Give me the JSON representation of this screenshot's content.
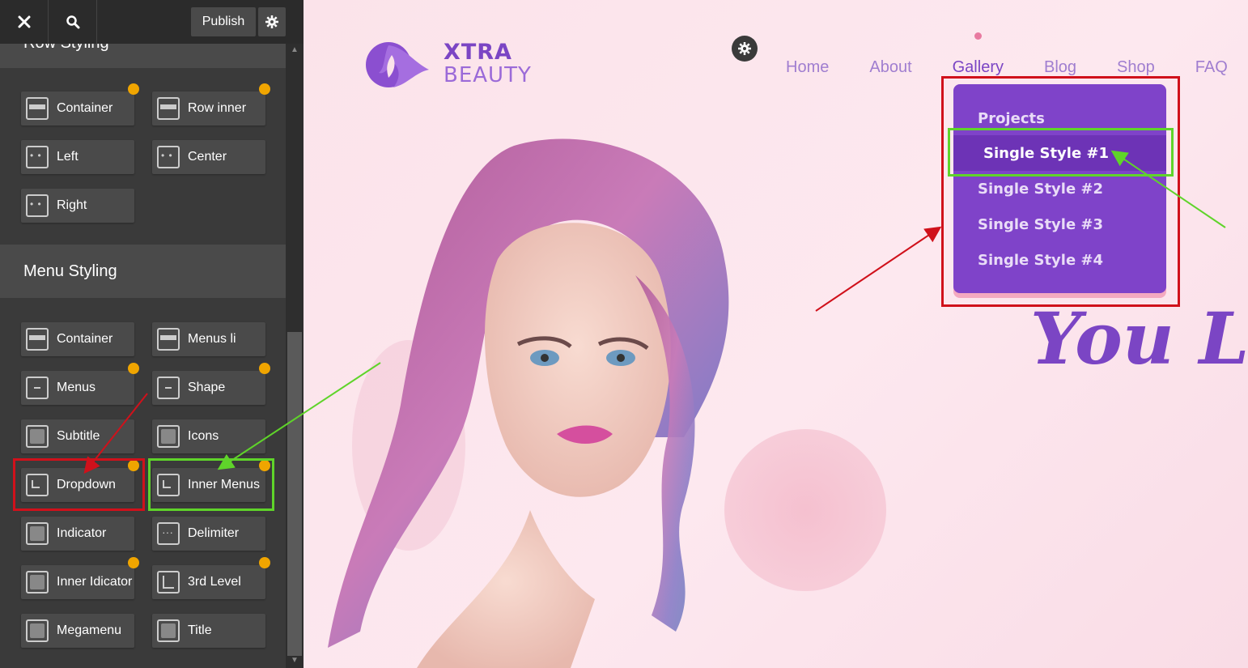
{
  "toolbar": {
    "publish_label": "Publish"
  },
  "sections": {
    "row_styling": "Row Styling",
    "menu_styling": "Menu Styling"
  },
  "row_tiles": [
    {
      "label": "Container",
      "icon": "container-icon"
    },
    {
      "label": "Row inner",
      "icon": "row-inner-icon"
    },
    {
      "label": "Left",
      "icon": "align-left-icon"
    },
    {
      "label": "Center",
      "icon": "align-center-icon"
    },
    {
      "label": "Right",
      "icon": "align-right-icon"
    }
  ],
  "menu_tiles": [
    {
      "label": "Container",
      "icon": "container-icon"
    },
    {
      "label": "Menus li",
      "icon": "menus-li-icon"
    },
    {
      "label": "Menus",
      "icon": "menus-icon"
    },
    {
      "label": "Shape",
      "icon": "shape-icon"
    },
    {
      "label": "Subtitle",
      "icon": "subtitle-icon"
    },
    {
      "label": "Icons",
      "icon": "icons-icon"
    },
    {
      "label": "Dropdown",
      "icon": "dropdown-icon"
    },
    {
      "label": "Inner Menus",
      "icon": "inner-menus-icon"
    },
    {
      "label": "Indicator",
      "icon": "indicator-icon"
    },
    {
      "label": "Delimiter",
      "icon": "delimiter-icon"
    },
    {
      "label": "Inner Idicator",
      "icon": "inner-indicator-icon"
    },
    {
      "label": "3rd Level",
      "icon": "third-level-icon"
    },
    {
      "label": "Megamenu",
      "icon": "megamenu-icon"
    },
    {
      "label": "Title",
      "icon": "title-icon"
    }
  ],
  "site": {
    "logo_line1": "XTRA",
    "logo_line2": "BEAUTY",
    "nav": [
      "Home",
      "About",
      "Gallery",
      "Blog",
      "Shop",
      "FAQ"
    ],
    "active_nav": "Gallery",
    "dropdown": [
      "Projects",
      "Single Style #1",
      "Single Style #2",
      "Single Style #3",
      "Single Style #4"
    ],
    "active_dropdown": "Single Style #1",
    "headline": "You Lo"
  },
  "colors": {
    "brand_purple": "#7b45c4",
    "dropdown_bg": "#7f43c9",
    "highlight_red": "#d0111b",
    "highlight_green": "#5fd42a",
    "modified_dot": "#f0a500"
  }
}
